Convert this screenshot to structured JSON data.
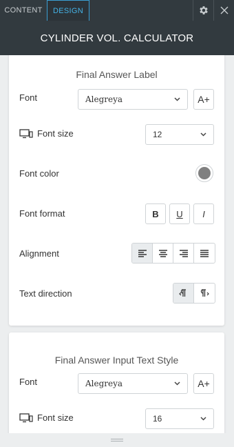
{
  "tabs": {
    "content": "CONTENT",
    "design": "DESIGN"
  },
  "title": "CYLINDER VOL. CALCULATOR",
  "section1": {
    "title": "Final Answer Label",
    "font_label": "Font",
    "font_value": "Alegreya",
    "font_size_label": "Font size",
    "font_size_value": "12",
    "font_color_label": "Font color",
    "font_color": "#808080",
    "font_format_label": "Font format",
    "format_bold": "B",
    "format_underline": "U",
    "format_italic": "I",
    "alignment_label": "Alignment",
    "text_direction_label": "Text direction",
    "font_add_btn": "A+"
  },
  "section2": {
    "title": "Final Answer Input Text Style",
    "font_label": "Font",
    "font_value": "Alegreya",
    "font_size_label": "Font size",
    "font_size_value": "16",
    "font_add_btn": "A+"
  },
  "colors": {
    "accent": "#3a9fd4",
    "header_bg": "#323a3f"
  }
}
